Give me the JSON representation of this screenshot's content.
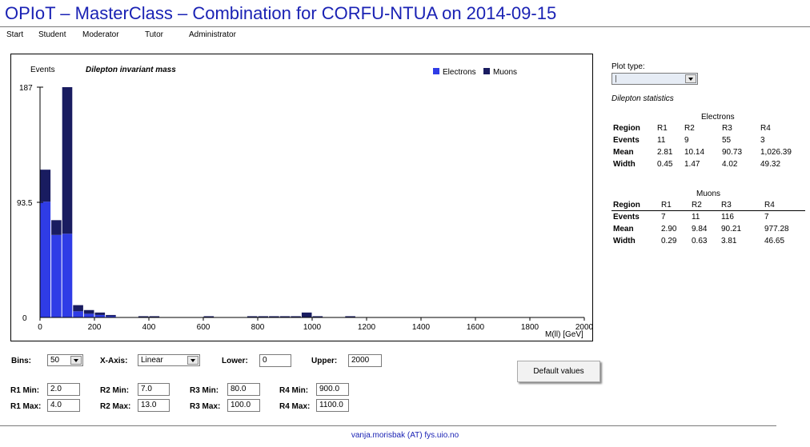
{
  "title": "OPIoT – MasterClass – Combination for CORFU-NTUA on 2014-09-15",
  "nav": [
    "Start",
    "Student",
    "Moderator",
    "Tutor",
    "Administrator"
  ],
  "chart_data": {
    "type": "bar",
    "title": "Dilepton invariant mass",
    "ylabel": "Events",
    "xlabel": "M(ll) [GeV]",
    "ylim": [
      0,
      187
    ],
    "yticks": [
      "0",
      "93.5",
      "187"
    ],
    "xlim": [
      0,
      2000
    ],
    "xticks": [
      "0",
      "200",
      "400",
      "600",
      "800",
      "1000",
      "1200",
      "1400",
      "1600",
      "1800",
      "2000"
    ],
    "bin_width": 40,
    "stacked": true,
    "legend_position": "top-right",
    "series": [
      {
        "name": "Electrons",
        "color": "#2f3ce6",
        "bins": [
          {
            "x": 0,
            "value": 94
          },
          {
            "x": 40,
            "value": 67
          },
          {
            "x": 80,
            "value": 68
          },
          {
            "x": 120,
            "value": 5
          },
          {
            "x": 160,
            "value": 3
          },
          {
            "x": 200,
            "value": 2
          },
          {
            "x": 240,
            "value": 1
          }
        ]
      },
      {
        "name": "Muons",
        "color": "#191c60",
        "bins": [
          {
            "x": 0,
            "value": 26
          },
          {
            "x": 40,
            "value": 12
          },
          {
            "x": 80,
            "value": 119
          },
          {
            "x": 120,
            "value": 5
          },
          {
            "x": 160,
            "value": 3
          },
          {
            "x": 200,
            "value": 2
          },
          {
            "x": 240,
            "value": 1
          },
          {
            "x": 360,
            "value": 1
          },
          {
            "x": 400,
            "value": 1
          },
          {
            "x": 600,
            "value": 1
          },
          {
            "x": 760,
            "value": 1
          },
          {
            "x": 800,
            "value": 1
          },
          {
            "x": 840,
            "value": 1
          },
          {
            "x": 880,
            "value": 1
          },
          {
            "x": 920,
            "value": 1
          },
          {
            "x": 960,
            "value": 4
          },
          {
            "x": 1000,
            "value": 1
          },
          {
            "x": 1120,
            "value": 1
          }
        ]
      }
    ]
  },
  "controls": {
    "bins_label": "Bins:",
    "bins_value": "50",
    "xaxis_label": "X-Axis:",
    "xaxis_value": "Linear",
    "lower_label": "Lower:",
    "lower_value": "0",
    "upper_label": "Upper:",
    "upper_value": "2000",
    "default_button": "Default values",
    "regions": [
      {
        "min_label": "R1 Min:",
        "min": "2.0",
        "max_label": "R1 Max:",
        "max": "4.0"
      },
      {
        "min_label": "R2 Min:",
        "min": "7.0",
        "max_label": "R2 Max:",
        "max": "13.0"
      },
      {
        "min_label": "R3 Min:",
        "min": "80.0",
        "max_label": "R3 Max:",
        "max": "100.0"
      },
      {
        "min_label": "R4 Min:",
        "min": "900.0",
        "max_label": "R4 Max:",
        "max": "1100.0"
      }
    ]
  },
  "side": {
    "plot_type_label": "Plot type:",
    "stats_title": "Dilepton statistics",
    "electrons": {
      "caption": "Electrons",
      "header": [
        "Region",
        "R1",
        "R2",
        "R3",
        "R4"
      ],
      "rows": [
        [
          "Events",
          "11",
          "9",
          "55",
          "3"
        ],
        [
          "Mean",
          "2.81",
          "10.14",
          "90.73",
          "1,026.39"
        ],
        [
          "Width",
          "0.45",
          "1.47",
          "4.02",
          "49.32"
        ]
      ]
    },
    "muons": {
      "caption": "Muons",
      "header": [
        "Region",
        "R1",
        "R2",
        "R3",
        "R4"
      ],
      "rows": [
        [
          "Events",
          "7",
          "11",
          "116",
          "7"
        ],
        [
          "Mean",
          "2.90",
          "9.84",
          "90.21",
          "977.28"
        ],
        [
          "Width",
          "0.29",
          "0.63",
          "3.81",
          "46.65"
        ]
      ]
    }
  },
  "footer": "vanja.morisbak (AT) fys.uio.no"
}
